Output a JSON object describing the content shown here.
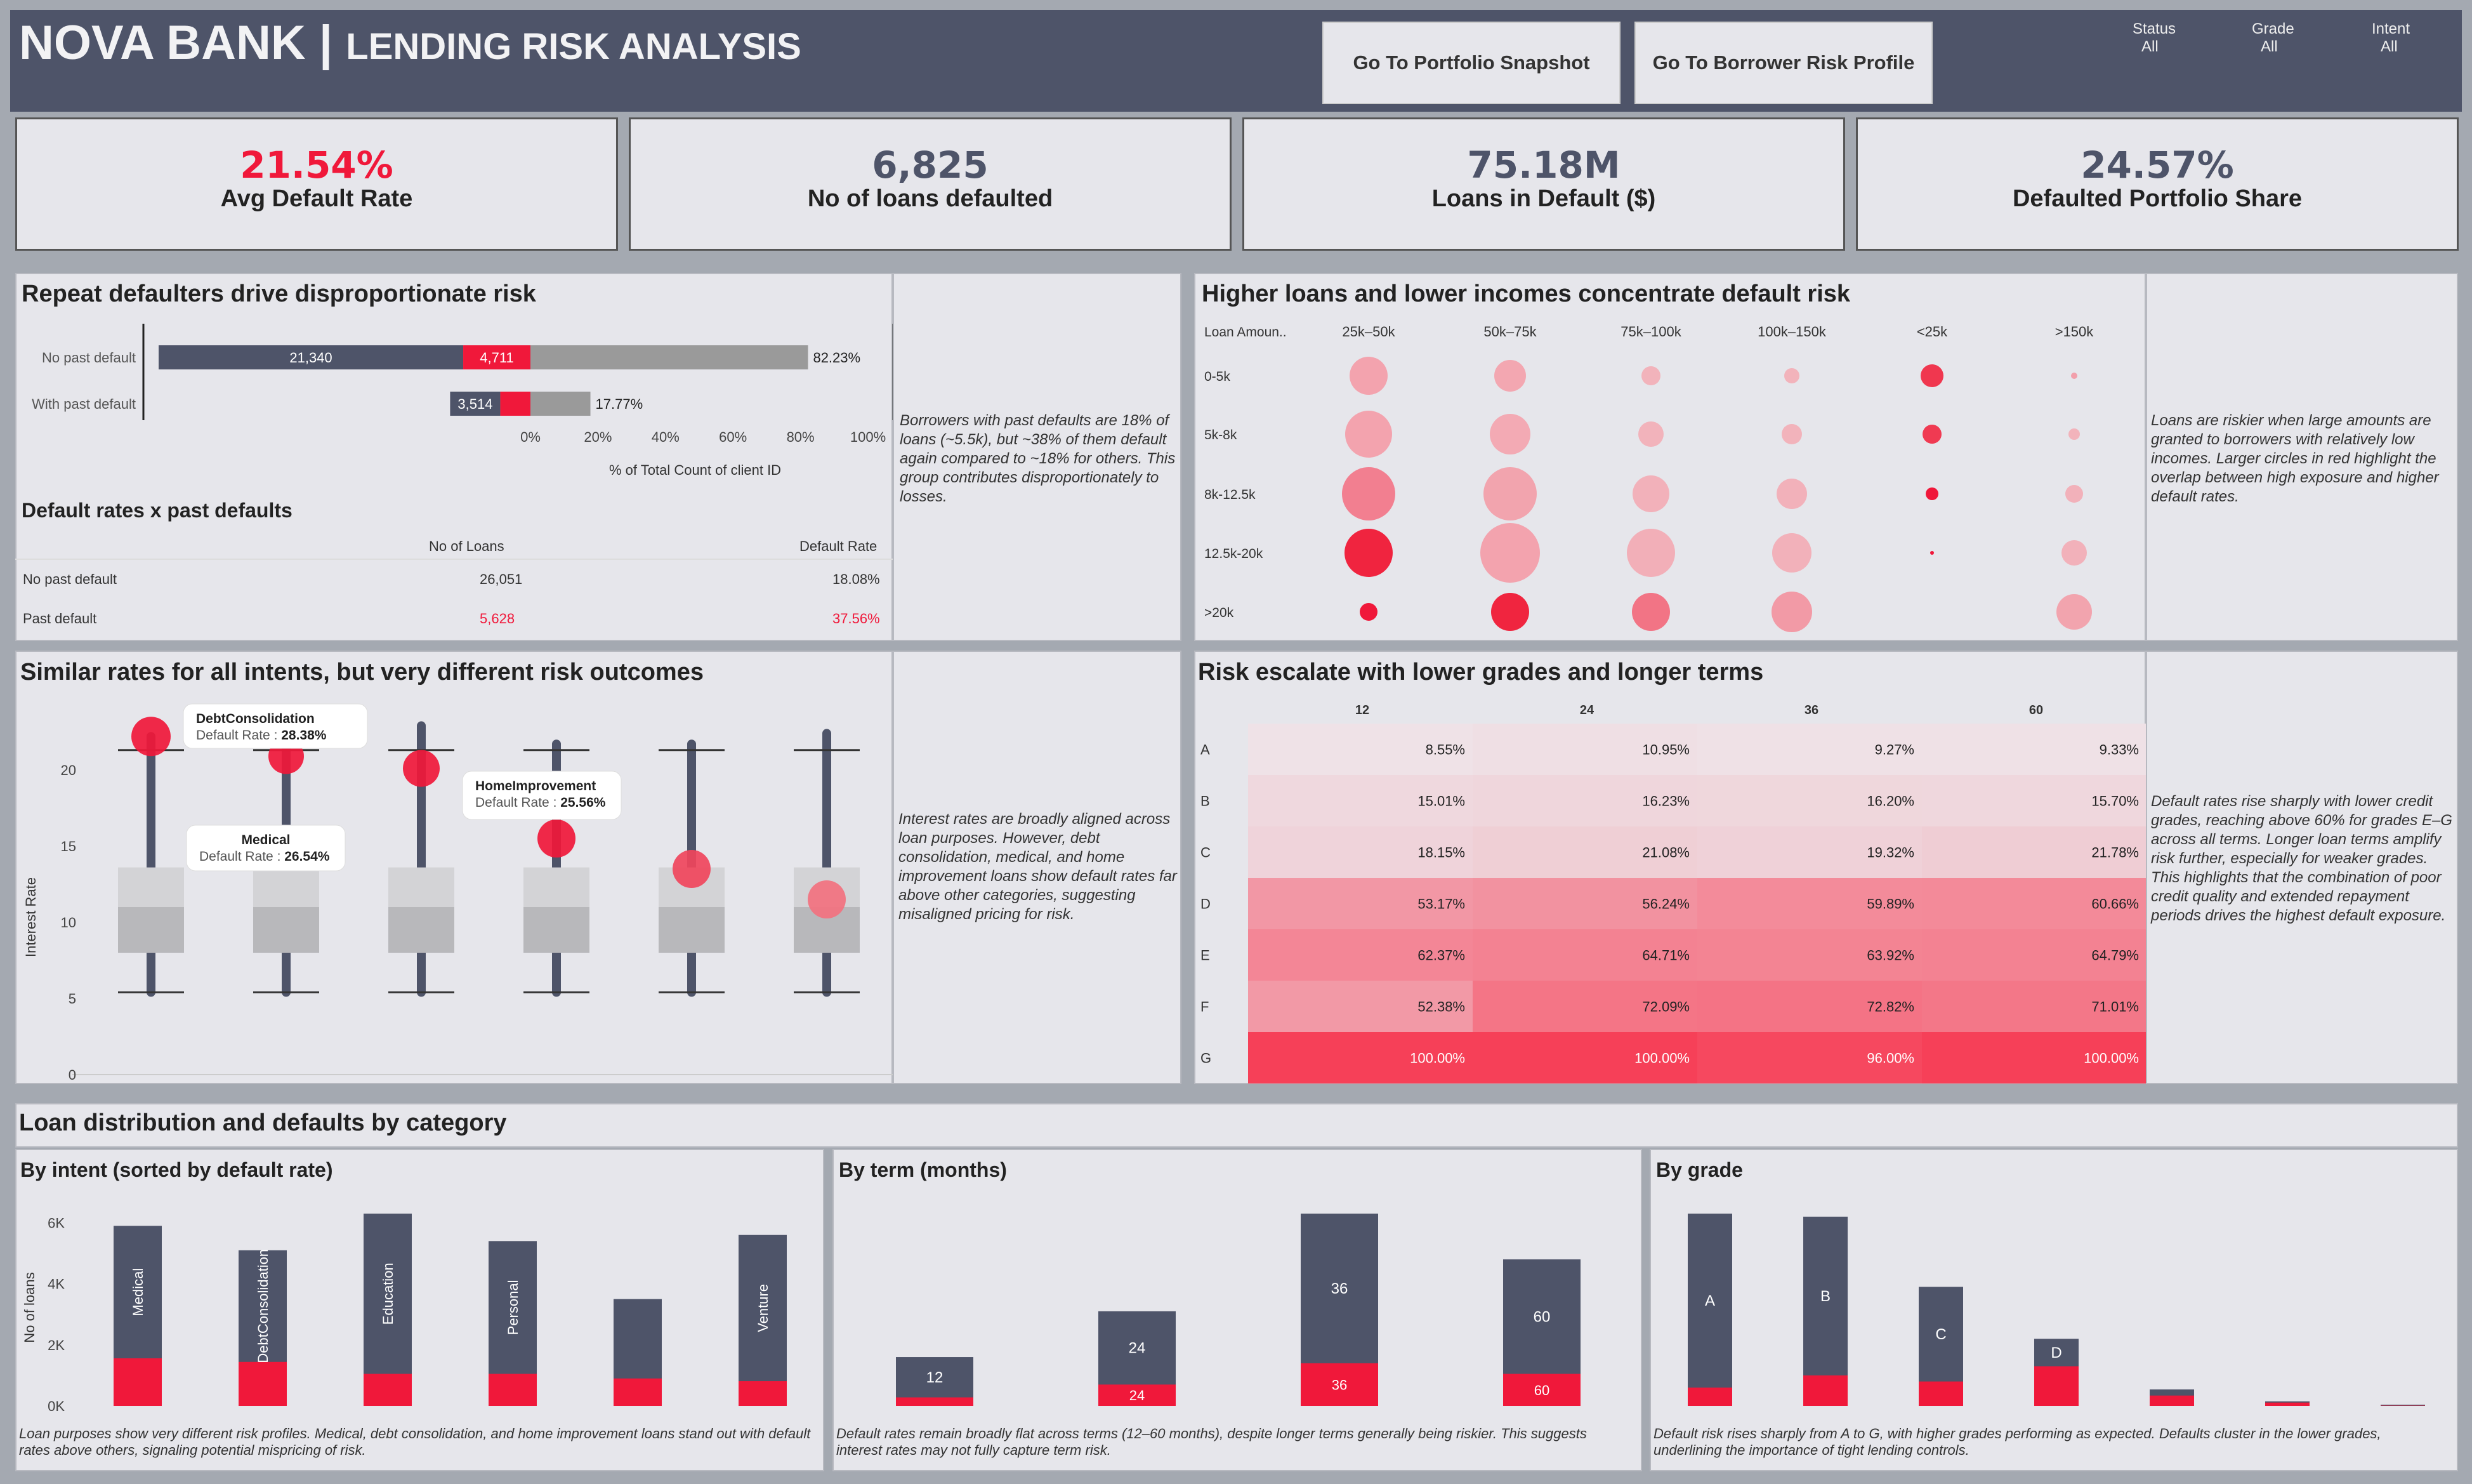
{
  "header": {
    "brand": "NOVA BANK",
    "separator": " | ",
    "subtitle": "LENDING RISK ANALYSIS",
    "nav": [
      "Go To Portfolio Snapshot",
      "Go To Borrower Risk Profile"
    ],
    "filters": [
      {
        "label": "Status",
        "value": "All"
      },
      {
        "label": "Grade",
        "value": "All"
      },
      {
        "label": "Intent",
        "value": "All"
      }
    ]
  },
  "kpis": [
    {
      "value": "21.54%",
      "label": "Avg Default Rate",
      "color": "#f0183a"
    },
    {
      "value": "6,825",
      "label": "No of loans defaulted",
      "color": "#4e5469"
    },
    {
      "value": "75.18M",
      "label": "Loans in Default ($)",
      "color": "#4e5469"
    },
    {
      "value": "24.57%",
      "label": "Defaulted Portfolio Share",
      "color": "#4e5469"
    }
  ],
  "repeat": {
    "title": "Repeat defaulters drive disproportionate risk",
    "rows": [
      {
        "label": "No past default",
        "nondefault": 21340,
        "default": 4711,
        "share": 82.23,
        "nd_label": "21,340",
        "d_label": "4,711",
        "share_label": "82.23%"
      },
      {
        "label": "With  past default",
        "nondefault": 3514,
        "default": 2114,
        "share": 17.77,
        "nd_label": "3,514",
        "d_label": "",
        "share_label": "17.77%"
      }
    ],
    "axis_ticks": [
      "0%",
      "20%",
      "40%",
      "60%",
      "80%",
      "100%"
    ],
    "axis_label": "% of Total Count of client ID",
    "table_title": "Default rates x past defaults",
    "col_loans": "No of Loans",
    "col_rate": "Default Rate",
    "table": [
      {
        "label": "No past default",
        "loans": "26,051",
        "rate": "18.08%"
      },
      {
        "label": "Past default",
        "loans": "5,628",
        "rate": "37.56%"
      }
    ],
    "note": "Borrowers with past defaults are 18% of loans (~5.5k), but ~38% of them default again compared to ~18% for others. This group contributes disproportionately to losses."
  },
  "bubble": {
    "title": "Higher loans and lower incomes concentrate default risk",
    "row_header": "Loan Amoun..",
    "cols": [
      "25k–50k",
      "50k–75k",
      "75k–100k",
      "100k–150k",
      "<25k",
      ">150k"
    ],
    "rows": [
      "0-5k",
      "5k-8k",
      "8k-12.5k",
      "12.5k-20k",
      ">20k"
    ],
    "note": "Loans are riskier when large amounts are granted to borrowers with relatively low incomes. Larger circles in red highlight the overlap between high exposure and higher default rates."
  },
  "boxplot": {
    "title": "Similar rates for all intents, but very different risk outcomes",
    "ylabel": "Interest Rate",
    "yticks": [
      "0",
      "5",
      "10",
      "15",
      "20"
    ],
    "callouts": [
      {
        "name": "DebtConsolidation",
        "rate": "28.38%"
      },
      {
        "name": "Medical",
        "rate": "26.54%"
      },
      {
        "name": "HomeImprovement",
        "rate": "25.56%"
      }
    ],
    "rate_label": "Default Rate : ",
    "note": "Interest rates are broadly aligned across loan purposes. However, debt consolidation, medical, and home improvement loans show default rates far above other categories, suggesting misaligned pricing for risk."
  },
  "heatmap": {
    "title": "Risk escalate with lower grades and longer terms",
    "terms": [
      "12",
      "24",
      "36",
      "60"
    ],
    "grades": [
      "A",
      "B",
      "C",
      "D",
      "E",
      "F",
      "G"
    ],
    "values": [
      [
        "8.55%",
        "10.95%",
        "9.27%",
        "9.33%"
      ],
      [
        "15.01%",
        "16.23%",
        "16.20%",
        "15.70%"
      ],
      [
        "18.15%",
        "21.08%",
        "19.32%",
        "21.78%"
      ],
      [
        "53.17%",
        "56.24%",
        "59.89%",
        "60.66%"
      ],
      [
        "62.37%",
        "64.71%",
        "63.92%",
        "64.79%"
      ],
      [
        "52.38%",
        "72.09%",
        "72.82%",
        "71.01%"
      ],
      [
        "100.00%",
        "100.00%",
        "96.00%",
        "100.00%"
      ]
    ],
    "note": "Default rates rise sharply with lower credit grades, reaching above 60% for grades E–G across all terms. Longer loan terms amplify risk further, especially for weaker grades. This highlights that the combination of poor credit quality and extended repayment periods drives the highest default exposure."
  },
  "dist": {
    "title": "Loan distribution and defaults by category",
    "intent": {
      "title": "By intent (sorted by default rate)",
      "ylabel": "No of loans",
      "yticks": [
        "0K",
        "2K",
        "4K",
        "6K"
      ],
      "bars": [
        {
          "label": "Medical",
          "total": 5900,
          "default": 1560
        },
        {
          "label": "DebtConsolidation",
          "total": 5100,
          "default": 1440
        },
        {
          "label": "Education",
          "total": 6300,
          "default": 1050
        },
        {
          "label": "Personal",
          "total": 5400,
          "default": 1050
        },
        {
          "label": "",
          "total": 3500,
          "default": 900
        },
        {
          "label": "Venture",
          "total": 5600,
          "default": 810
        }
      ],
      "note": "Loan purposes show very different risk profiles. Medical, debt consolidation, and home improvement loans stand out with default rates above others, signaling potential mispricing of risk."
    },
    "term": {
      "title": "By term (months)",
      "bars": [
        {
          "label": "12",
          "total": 1600,
          "default": 280,
          "dlabel": ""
        },
        {
          "label": "24",
          "total": 3100,
          "default": 700,
          "dlabel": "24"
        },
        {
          "label": "36",
          "total": 6300,
          "default": 1400,
          "dlabel": "36"
        },
        {
          "label": "60",
          "total": 4800,
          "default": 1050,
          "dlabel": "60"
        }
      ],
      "note": "Default rates remain broadly flat across terms (12–60 months), despite longer terms generally being riskier. This suggests interest rates may not fully capture term risk."
    },
    "grade": {
      "title": "By grade",
      "bars": [
        {
          "label": "A",
          "total": 6300,
          "default": 600
        },
        {
          "label": "B",
          "total": 6200,
          "default": 1000
        },
        {
          "label": "C",
          "total": 3900,
          "default": 800
        },
        {
          "label": "D",
          "total": 2200,
          "default": 1300
        },
        {
          "label": "",
          "total": 540,
          "default": 340
        },
        {
          "label": "",
          "total": 150,
          "default": 110
        },
        {
          "label": "",
          "total": 40,
          "default": 10
        }
      ],
      "note": "Default risk rises sharply from A to G, with higher grades performing as expected. Defaults cluster in the lower grades, underlining the importance of tight lending controls."
    }
  },
  "colors": {
    "navy": "#4e5469",
    "red": "#f0183a",
    "grey": "#9a9a9a"
  }
}
